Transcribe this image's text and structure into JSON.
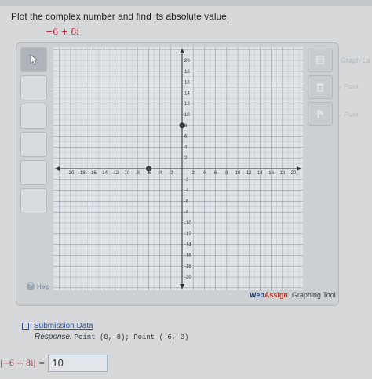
{
  "question": {
    "prompt": "Plot the complex number and find its absolute value.",
    "expression": "−6 + 8i"
  },
  "tool": {
    "brand_web": "Web",
    "brand_assign": "Assign",
    "brand_rest": ". Graphing Tool",
    "help_label": "Help",
    "side_panel_title": "Graph La",
    "side_items": [
      "Point",
      "Point"
    ],
    "tick_labels_x": [
      "-20",
      "-18",
      "-16",
      "-14",
      "-12",
      "-10",
      "-8",
      "-6",
      "-4",
      "-2",
      "2",
      "4",
      "6",
      "8",
      "10",
      "12",
      "14",
      "16",
      "18",
      "20"
    ],
    "tick_labels_y": [
      "20",
      "18",
      "16",
      "14",
      "12",
      "10",
      "8",
      "6",
      "4",
      "2",
      "-2",
      "-4",
      "-6",
      "-8",
      "-10",
      "-12",
      "-14",
      "-16",
      "-18",
      "-20"
    ],
    "points": [
      {
        "x": 0,
        "y": 8
      },
      {
        "x": -6,
        "y": 0
      }
    ],
    "axis_range": [
      -22,
      22
    ]
  },
  "submission": {
    "title": "Submission Data",
    "response_label": "Response:",
    "response_value": "Point (0, 8); Point (-6, 0)"
  },
  "answer": {
    "expression": "|−6 + 8i| =",
    "value": "10"
  },
  "colors": {
    "point": "#3b3e44",
    "grid": "#8f97a0",
    "axis": "#2e2e2e",
    "expr_red": "#b0243a",
    "link_blue": "#2a53a0"
  }
}
